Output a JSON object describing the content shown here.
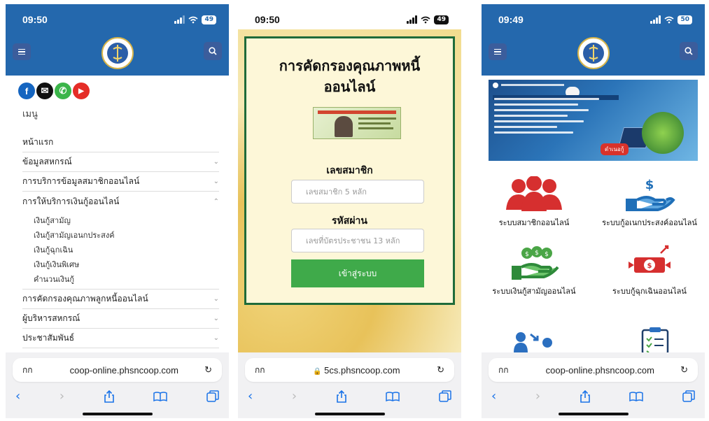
{
  "phone1": {
    "status": {
      "time": "09:50",
      "battery": "49"
    },
    "social": [
      "f",
      "✉",
      "✆",
      "▶"
    ],
    "menu_title": "เมนู",
    "menu_items": [
      {
        "label": "หน้าแรก",
        "chevron": ""
      },
      {
        "label": "ข้อมูลสหกรณ์",
        "chevron": "⌄"
      },
      {
        "label": "การบริการข้อมูลสมาชิกออนไลน์",
        "chevron": "⌄"
      },
      {
        "label": "การให้บริการเงินกู้ออนไลน์",
        "chevron": "⌃"
      }
    ],
    "sub_items": [
      "เงินกู้สามัญ",
      "เงินกู้สามัญเอนกประสงค์",
      "เงินกู้ฉุกเฉิน",
      "เงินกู้เงินพิเศษ",
      "คำนวนเงินกู้"
    ],
    "menu_items_after": [
      {
        "label": "การคัดกรองคุณภาพลูกหนี้ออนไลน์",
        "chevron": "⌄"
      },
      {
        "label": "ผู้บริหารสหกรณ์",
        "chevron": "⌄"
      },
      {
        "label": "ประชาสัมพันธ์",
        "chevron": "⌄"
      }
    ],
    "browser": {
      "aa": "กก",
      "url": "coop-online.phsncoop.com",
      "reload": "↻"
    }
  },
  "phone2": {
    "status": {
      "time": "09:50",
      "battery": "49"
    },
    "title_line1": "การคัดกรองคุณภาพหนี้",
    "title_line2": "ออนไลน์",
    "member_label": "เลขสมาชิก",
    "member_placeholder": "เลขสมาชิก 5 หลัก",
    "password_label": "รหัสผ่าน",
    "password_placeholder": "เลขที่บัตรประชาชน 13 หลัก",
    "login_button": "เข้าสู่ระบบ",
    "browser": {
      "aa": "กก",
      "url": "5cs.phsncoop.com",
      "lock": "🔒",
      "reload": "↻"
    }
  },
  "phone3": {
    "status": {
      "time": "09:49",
      "battery": "50"
    },
    "banner_tag": "ดำเนอกู้",
    "services": [
      {
        "label": "ระบบสมาชิกออนไลน์",
        "icon": "members-icon"
      },
      {
        "label": "ระบบกู้อเนกประสงค์ออนไลน์",
        "icon": "hand-dollar-icon"
      },
      {
        "label": "ระบบเงินกู้สามัญออนไลน์",
        "icon": "money-bags-icon"
      },
      {
        "label": "ระบบกู้ฉุกเฉินออนไลน์",
        "icon": "emergency-money-icon"
      }
    ],
    "browser": {
      "aa": "กก",
      "url": "coop-online.phsncoop.com",
      "reload": "↻"
    }
  },
  "colors": {
    "header_blue": "#2468ad",
    "login_green": "#3faa4a",
    "card_border": "#1e6b3a",
    "ios_blue": "#1a73e8"
  }
}
